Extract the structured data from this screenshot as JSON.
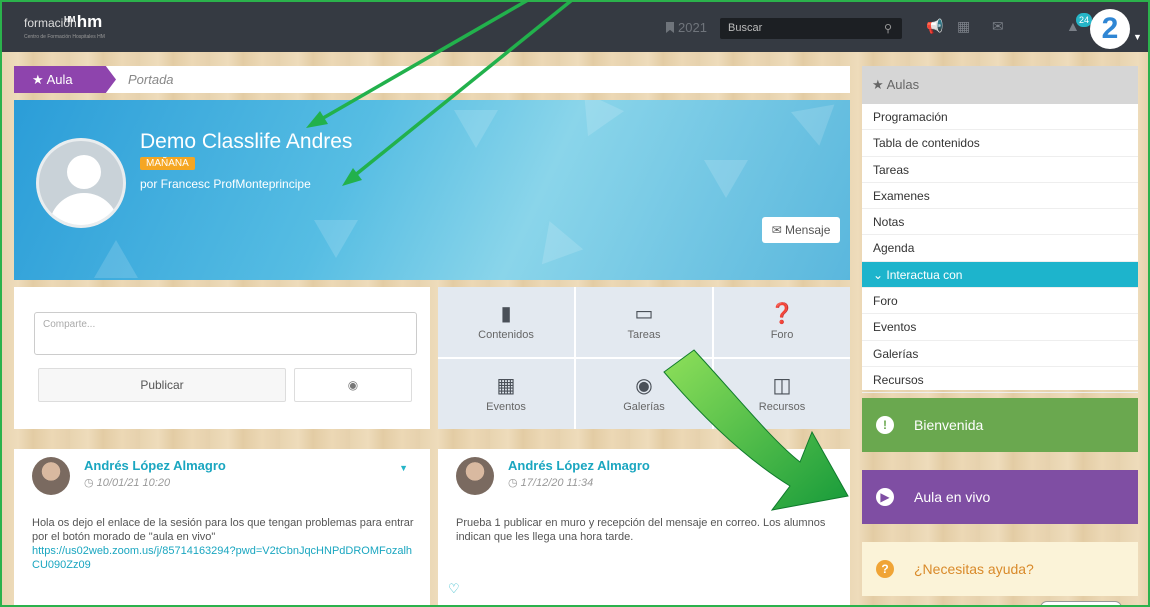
{
  "topbar": {
    "logo_text": "formación",
    "logo_bold": "hm",
    "logo_mark": "HM",
    "logo_small": "Centro de Formación Hospitales HM",
    "year": "2021",
    "search_placeholder": "Buscar",
    "notif_count": "24",
    "avatar_label": "2"
  },
  "breadcrumb": {
    "root": "Aula",
    "current": "Portada"
  },
  "course": {
    "title": "Demo Classlife Andres",
    "tag": "MAÑANA",
    "teacher": "por Francesc ProfMonteprincipe",
    "message_button": "Mensaje"
  },
  "composer": {
    "placeholder": "Comparte...",
    "publish_label": "Publicar"
  },
  "tiles": [
    {
      "label": "Contenidos",
      "icon": "bookmark-icon"
    },
    {
      "label": "Tareas",
      "icon": "book-icon"
    },
    {
      "label": "Foro",
      "icon": "question-icon"
    },
    {
      "label": "Eventos",
      "icon": "calendar-icon"
    },
    {
      "label": "Galerías",
      "icon": "camera-icon"
    },
    {
      "label": "Recursos",
      "icon": "folder-icon"
    }
  ],
  "posts": [
    {
      "author": "Andrés López Almagro",
      "date": "10/01/21 10:20",
      "text": "Hola os dejo el enlace de la sesión para los que tengan problemas para entrar por el botón morado de \"aula en vivo\"",
      "link": "https://us02web.zoom.us/j/85714163294?pwd=V2tCbnJqcHNPdDROMFozalhCU090Zz09"
    },
    {
      "author": "Andrés López Almagro",
      "date": "17/12/20 11:34",
      "text": "Prueba 1 publicar en muro y recepción del mensaje en correo. Los alumnos indican que les llega una hora tarde."
    }
  ],
  "sidebar": {
    "title": "Aulas",
    "items": [
      "Programación",
      "Tabla de contenidos",
      "Tareas",
      "Examenes",
      "Notas",
      "Agenda"
    ],
    "section": "Interactua con",
    "section_items": [
      "Foro",
      "Eventos",
      "Galerías",
      "Recursos"
    ]
  },
  "cards": {
    "welcome": "Bienvenida",
    "live": "Aula en vivo",
    "help": "¿Necesitas ayuda?"
  },
  "colors": {
    "topbar": "#353a42",
    "purple": "#8e44ad",
    "teal": "#1db4cc",
    "green_card": "#6aa84f",
    "live_card": "#7f4ea3",
    "annotation_arrow": "#22b14c"
  }
}
